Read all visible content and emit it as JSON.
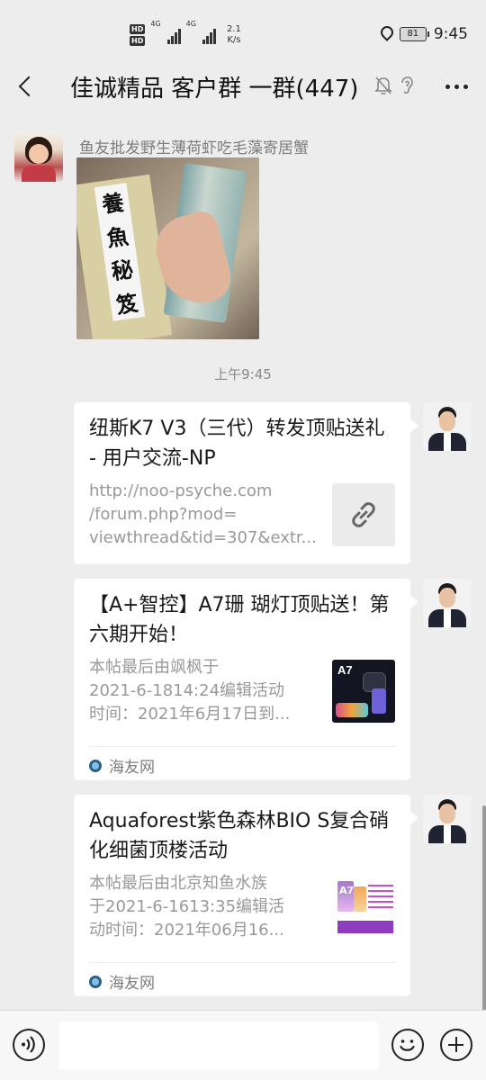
{
  "status_bar": {
    "hd_badges": [
      "HD",
      "HD"
    ],
    "network_labels": [
      "4G",
      "4G"
    ],
    "net_speed_value": "2.1",
    "net_speed_unit": "K/s",
    "battery": "81",
    "time": "9:45"
  },
  "header": {
    "title": "佳诚精品 客户群 一群(447)"
  },
  "messages": [
    {
      "type": "image",
      "sender": "鱼友批发野生薄荷虾吃毛藻寄居蟹",
      "image_text": [
        "養",
        "魚",
        "秘",
        "笈"
      ]
    },
    {
      "type": "time",
      "text": "上午9:45"
    },
    {
      "type": "link_card",
      "title": "纽斯K7 V3（三代）转发顶贴送礼 - 用户交流-NP",
      "desc": [
        "http://noo-psyche.com",
        "/forum.php?mod=",
        "viewthread&tid=307&extr..."
      ],
      "thumb": "link-icon"
    },
    {
      "type": "link_card",
      "title": "【A+智控】A7珊 瑚灯顶贴送！第六期开始！",
      "desc": [
        "本帖最后由飒枫于",
        "2021-6-1814:24编辑活动",
        "时间：2021年6月17日到..."
      ],
      "thumb_label": "A7",
      "source": "海友网"
    },
    {
      "type": "link_card",
      "title": "Aquaforest紫色森林BIO S复合硝化细菌顶楼活动",
      "desc": [
        "本帖最后由北京知鱼水族",
        "于2021-6-1613:35编辑活",
        "动时间：2021年06月16..."
      ],
      "thumb_label": "A7",
      "source": "海友网"
    }
  ],
  "input": {
    "value": "",
    "placeholder": ""
  },
  "colors": {
    "background": "#ededed",
    "card": "#ffffff",
    "secondary_text": "#999999"
  }
}
